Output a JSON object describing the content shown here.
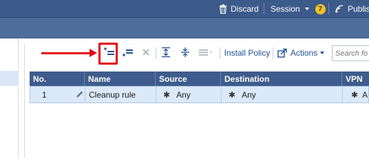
{
  "topbar": {
    "discard_label": "Discard",
    "session_label": "Session",
    "session_count": "7",
    "publish_label": "Publis"
  },
  "toolbar": {
    "install_policy_label": "Install Policy",
    "actions_label": "Actions",
    "search_placeholder": "Search fo"
  },
  "table": {
    "headers": [
      "No.",
      "Name",
      "Source",
      "Destination",
      "VPN"
    ],
    "rows": [
      {
        "no": "1",
        "name": "Cleanup rule",
        "source": "Any",
        "destination": "Any",
        "vpn": "A"
      }
    ]
  },
  "colors": {
    "topbar_bg": "#3c5a8a",
    "header_bg": "#3e5c8c",
    "row_selected_bg": "#dbe9f8",
    "highlight_red": "#e3000e",
    "badge_yellow": "#f3c221"
  },
  "icons": [
    "trash-icon",
    "chevron-down-icon",
    "publish-icon",
    "add-rule-above-icon",
    "add-rule-below-icon",
    "delete-rule-icon",
    "expand-section-icon",
    "collapse-section-icon",
    "more-options-icon",
    "actions-export-icon",
    "edit-pencil-icon",
    "any-star-icon"
  ]
}
